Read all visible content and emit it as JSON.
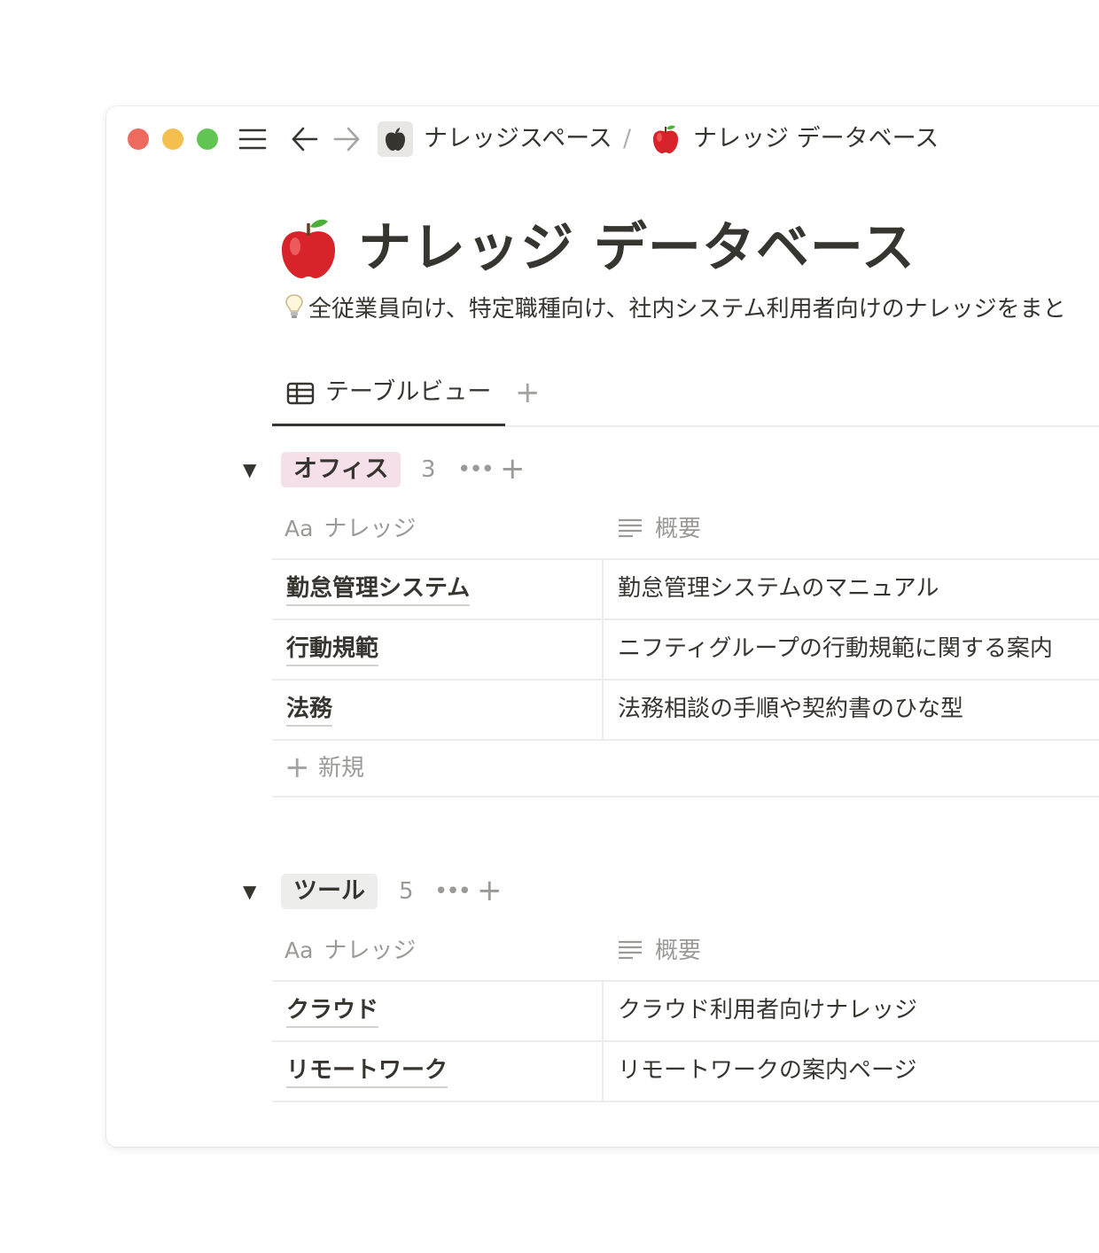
{
  "titlebar": {
    "breadcrumb_workspace": "ナレッジスペース",
    "breadcrumb_separator": "/",
    "breadcrumb_page": "ナレッジ データベース"
  },
  "page": {
    "title": "ナレッジ データベース",
    "description": "全従業員向け、特定職種向け、社内システム利用者向けのナレッジをまと"
  },
  "tabs": {
    "active_label": "テーブルビュー",
    "add_label": "+"
  },
  "columns": {
    "title_prefix": "Aa",
    "title_label": "ナレッジ",
    "summary_label": "概要"
  },
  "groups": [
    {
      "name": "オフィス",
      "count": "3",
      "more": "•••",
      "add": "+",
      "color": "#f5e0e9",
      "rows": [
        {
          "title": "勤怠管理システム",
          "summary": "勤怠管理システムのマニュアル"
        },
        {
          "title": "行動規範",
          "summary": "ニフティグループの行動規範に関する案内"
        },
        {
          "title": "法務",
          "summary": "法務相談の手順や契約書のひな型"
        }
      ],
      "new_label": "新規"
    },
    {
      "name": "ツール",
      "count": "5",
      "more": "•••",
      "add": "+",
      "color": "#ededeb",
      "rows": [
        {
          "title": "クラウド",
          "summary": "クラウド利用者向けナレッジ"
        },
        {
          "title": "リモートワーク",
          "summary": "リモートワークの案内ページ"
        }
      ]
    }
  ],
  "icons": {
    "close": "red-dot",
    "minimize": "yellow-dot",
    "zoom": "green-dot",
    "menu": "hamburger-icon",
    "back": "arrow-left-icon",
    "forward": "arrow-right-icon",
    "workspace": "apple-logo-icon",
    "page": "red-apple-icon",
    "tip": "lightbulb-icon",
    "table_view": "table-icon",
    "title_column": "aa-text-icon",
    "summary_column": "lines-icon"
  }
}
